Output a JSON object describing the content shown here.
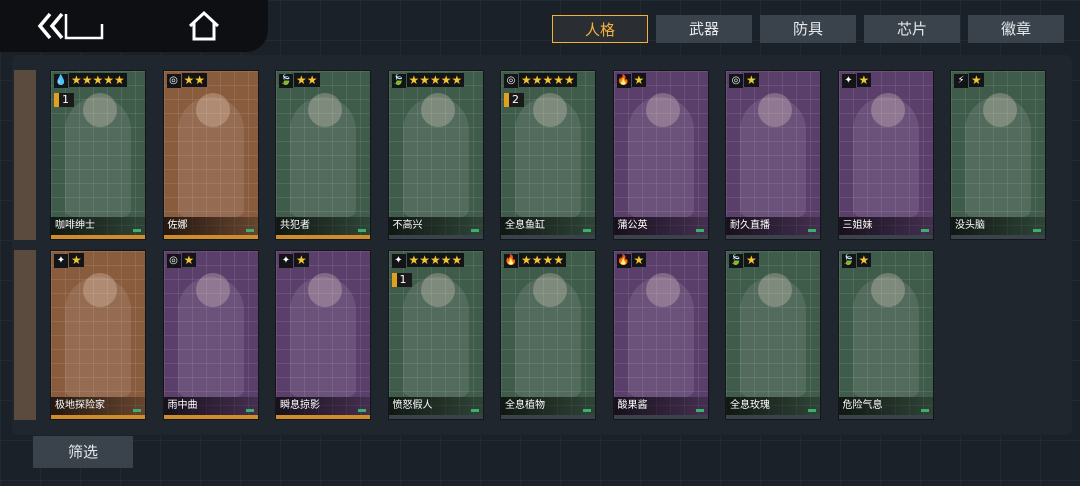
{
  "tabs": [
    {
      "label": "人格",
      "active": true
    },
    {
      "label": "武器",
      "active": false
    },
    {
      "label": "防具",
      "active": false
    },
    {
      "label": "芯片",
      "active": false
    },
    {
      "label": "徽章",
      "active": false
    }
  ],
  "filter_label": "筛选",
  "colors": {
    "accent": "#f4b23c",
    "star": "#f3c532",
    "bar_orange": "#e2a022"
  },
  "cards_row1": [
    {
      "name": "咖啡绅士",
      "element": "water",
      "elem_icon": "💧",
      "stars": "★★★★★",
      "badge": "1",
      "bg": "#3f5b4a",
      "bar": "#cf8c2a"
    },
    {
      "name": "佐娜",
      "element": "spiral",
      "elem_icon": "◎",
      "stars": "★★",
      "badge": "",
      "bg": "#8a5c3e",
      "bar": "#cf8c2a"
    },
    {
      "name": "共犯者",
      "element": "leaf",
      "elem_icon": "🍃",
      "stars": "★★",
      "badge": "",
      "bg": "#3f5b4a",
      "bar": "#cf8c2a"
    },
    {
      "name": "不高兴",
      "element": "leaf",
      "elem_icon": "🍃",
      "stars": "★★★★★",
      "badge": "",
      "bg": "#3f5b4a",
      "bar": "#3a434c"
    },
    {
      "name": "全息鱼缸",
      "element": "spiral",
      "elem_icon": "◎",
      "stars": "★★★★★",
      "badge": "2",
      "bg": "#3f5b4a",
      "bar": "#3a434c"
    },
    {
      "name": "蒲公英",
      "element": "fire",
      "elem_icon": "🔥",
      "stars": "★",
      "badge": "",
      "bg": "#5b3f6b",
      "bar": "#3a434c"
    },
    {
      "name": "耐久直播",
      "element": "spiral",
      "elem_icon": "◎",
      "stars": "★",
      "badge": "",
      "bg": "#5b3f6b",
      "bar": "#3a434c"
    },
    {
      "name": "三姐妹",
      "element": "star",
      "elem_icon": "✦",
      "stars": "★",
      "badge": "",
      "bg": "#5b3f6b",
      "bar": "#3a434c"
    },
    {
      "name": "没头脑",
      "element": "bolt",
      "elem_icon": "⚡",
      "stars": "★",
      "badge": "",
      "bg": "#3f5b4a",
      "bar": "#3a434c"
    }
  ],
  "cards_row2": [
    {
      "name": "极地探险家",
      "element": "star",
      "elem_icon": "✦",
      "stars": "★",
      "badge": "",
      "bg": "#8a5c3e",
      "bar": "#cf8c2a"
    },
    {
      "name": "雨中曲",
      "element": "spiral",
      "elem_icon": "◎",
      "stars": "★",
      "badge": "",
      "bg": "#5b3f6b",
      "bar": "#cf8c2a"
    },
    {
      "name": "瞬息掠影",
      "element": "star",
      "elem_icon": "✦",
      "stars": "★",
      "badge": "",
      "bg": "#5b3f6b",
      "bar": "#cf8c2a"
    },
    {
      "name": "愤怒假人",
      "element": "star",
      "elem_icon": "✦",
      "stars": "★★★★★",
      "badge": "1",
      "bg": "#3f5b4a",
      "bar": "#3a434c"
    },
    {
      "name": "全息植物",
      "element": "fire",
      "elem_icon": "🔥",
      "stars": "★★★★",
      "badge": "",
      "bg": "#3f5b4a",
      "bar": "#3a434c"
    },
    {
      "name": "酸果酱",
      "element": "fire",
      "elem_icon": "🔥",
      "stars": "★",
      "badge": "",
      "bg": "#5b3f6b",
      "bar": "#3a434c"
    },
    {
      "name": "全息玫瑰",
      "element": "leaf",
      "elem_icon": "🍃",
      "stars": "★",
      "badge": "",
      "bg": "#3f5b4a",
      "bar": "#3a434c"
    },
    {
      "name": "危险气息",
      "element": "leaf",
      "elem_icon": "🍃",
      "stars": "★",
      "badge": "",
      "bg": "#3f5b4a",
      "bar": "#3a434c"
    }
  ]
}
